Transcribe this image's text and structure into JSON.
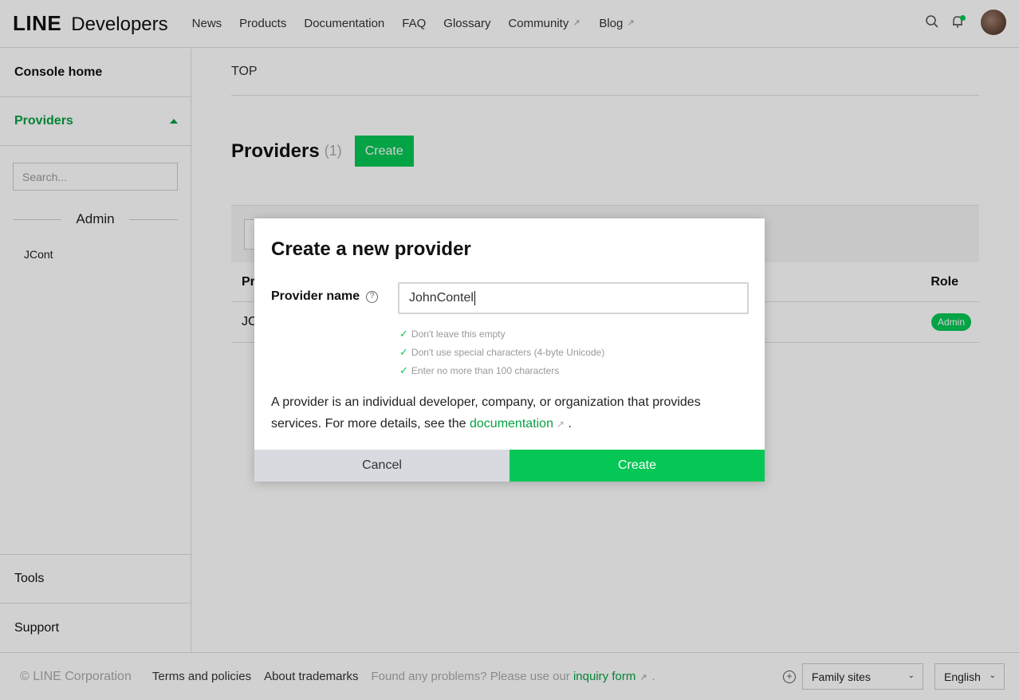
{
  "header": {
    "logo_line": "LINE",
    "logo_developers": "Developers",
    "nav": [
      {
        "label": "News",
        "external": false
      },
      {
        "label": "Products",
        "external": false
      },
      {
        "label": "Documentation",
        "external": false
      },
      {
        "label": "FAQ",
        "external": false
      },
      {
        "label": "Glossary",
        "external": false
      },
      {
        "label": "Community",
        "external": true
      },
      {
        "label": "Blog",
        "external": true
      }
    ]
  },
  "sidebar": {
    "home": "Console home",
    "providers": "Providers",
    "search_placeholder": "Search...",
    "group": "Admin",
    "items": [
      "JCont"
    ],
    "tools": "Tools",
    "support": "Support"
  },
  "main": {
    "breadcrumb": "TOP",
    "title": "Providers",
    "count": "(1)",
    "create": "Create",
    "table": {
      "col_provider": "Pr",
      "col_role": "Role",
      "rows": [
        {
          "name": "JC",
          "role": "Admin"
        }
      ]
    }
  },
  "modal": {
    "title": "Create a new provider",
    "field_label": "Provider name",
    "field_value": "JohnContel",
    "rules": [
      "Don't leave this empty",
      "Don't use special characters (4-byte Unicode)",
      "Enter no more than 100 characters"
    ],
    "desc_prefix": "A provider is an individual developer, company, or organization that provides services. For more details, see the",
    "desc_link": "documentation",
    "desc_suffix": ".",
    "cancel": "Cancel",
    "create": "Create"
  },
  "footer": {
    "copyright": "© LINE Corporation",
    "terms": "Terms and policies",
    "trademarks": "About trademarks",
    "note_prefix": "Found any problems? Please use our",
    "note_link": "inquiry form",
    "note_suffix": ".",
    "family_sites": "Family sites",
    "language": "English"
  },
  "colors": {
    "accent": "#06c755",
    "link": "#06a043",
    "cancel_bg": "#d7dadf"
  }
}
